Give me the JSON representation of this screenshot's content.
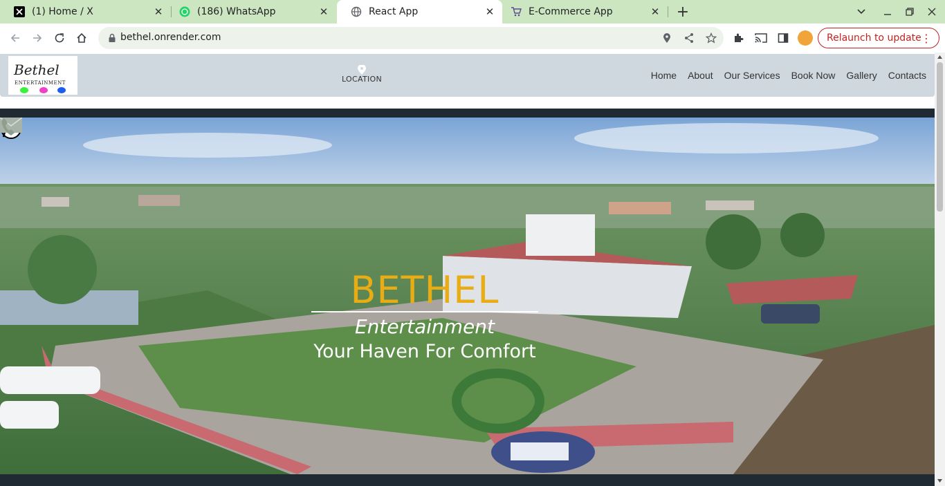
{
  "browser": {
    "tabs": [
      {
        "title": "(1) Home / X",
        "icon": "x-logo-icon"
      },
      {
        "title": "(186) WhatsApp",
        "icon": "whatsapp-icon"
      },
      {
        "title": "React App",
        "icon": "globe-icon",
        "active": true
      },
      {
        "title": "E-Commerce App",
        "icon": "cart-icon"
      }
    ],
    "new_tab": "+",
    "url": "bethel.onrender.com",
    "relaunch_label": "Relaunch to update"
  },
  "site": {
    "logo": {
      "name": "Bethel",
      "sub": "ENTERTAINMENT",
      "dot_colors": [
        "#3cf03c",
        "#f040c8",
        "#1a5ef0"
      ]
    },
    "location_label": "LOCATION",
    "menu": [
      "Home",
      "About",
      "Our Services",
      "Book Now",
      "Gallery",
      "Contacts"
    ],
    "hero": {
      "brand": "BETHEL",
      "subtitle": "Entertainment",
      "tagline": "Your Haven For Comfort"
    }
  },
  "colors": {
    "tab_strip": "#cde6c2",
    "navbar": "#cfd7df",
    "brand_gold": "#e8ad14",
    "dark_band": "#1f2a33",
    "relaunch": "#c5221f"
  }
}
